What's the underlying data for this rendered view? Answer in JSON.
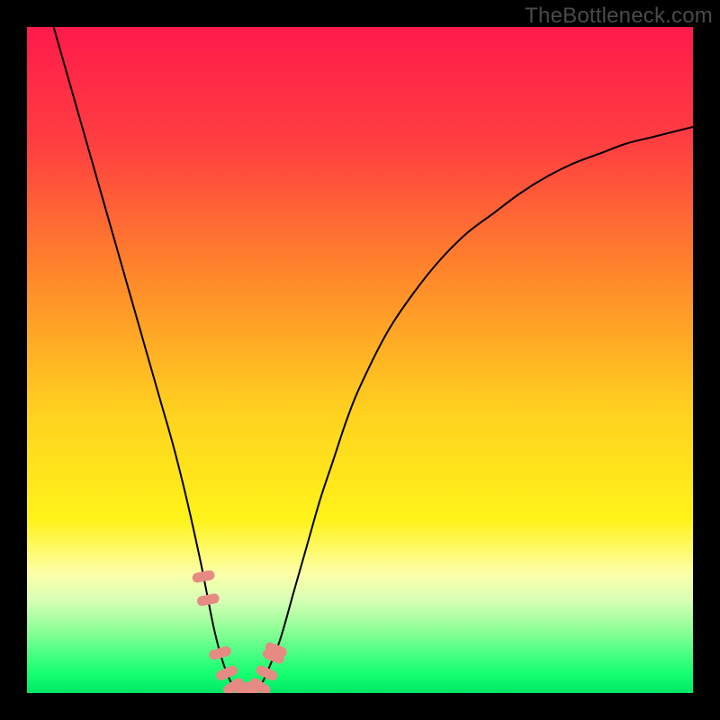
{
  "watermark": {
    "text": "TheBottleneck.com"
  },
  "chart_data": {
    "type": "line",
    "title": "",
    "xlabel": "",
    "ylabel": "",
    "xlim": [
      0,
      100
    ],
    "ylim": [
      0,
      100
    ],
    "series": [
      {
        "name": "bottleneck-curve",
        "x": [
          4,
          6,
          8,
          10,
          12,
          14,
          16,
          18,
          20,
          22,
          24,
          26,
          27,
          28,
          29,
          30,
          31,
          32,
          33,
          34,
          35,
          36,
          38,
          40,
          42,
          44,
          46,
          48,
          50,
          54,
          58,
          62,
          66,
          70,
          74,
          78,
          82,
          86,
          90,
          94,
          98,
          100
        ],
        "y": [
          100,
          93,
          86,
          79,
          72,
          65,
          58,
          51,
          44,
          37,
          29,
          20,
          15,
          10,
          6,
          3,
          1,
          0,
          0,
          0,
          1,
          3,
          8,
          15,
          22,
          29,
          35,
          41,
          46,
          54,
          60,
          65,
          69,
          72,
          75,
          77.5,
          79.5,
          81,
          82.5,
          83.5,
          84.5,
          85
        ]
      }
    ],
    "notch_markers": {
      "description": "salmon dashes along curve near minimum",
      "x": [
        26.5,
        27.2,
        29.0,
        30.0,
        31.0,
        32.0,
        33.0,
        34.0,
        35.0,
        36.0,
        37,
        37.4
      ]
    },
    "background_gradient": {
      "stops": [
        {
          "offset": 0.0,
          "color": "#ff1a4b"
        },
        {
          "offset": 0.18,
          "color": "#ff4040"
        },
        {
          "offset": 0.38,
          "color": "#ff8a2a"
        },
        {
          "offset": 0.58,
          "color": "#ffd21f"
        },
        {
          "offset": 0.74,
          "color": "#fff31a"
        },
        {
          "offset": 0.82,
          "color": "#fdffa8"
        },
        {
          "offset": 0.86,
          "color": "#d8ffb5"
        },
        {
          "offset": 0.9,
          "color": "#97ff9a"
        },
        {
          "offset": 0.94,
          "color": "#4cff83"
        },
        {
          "offset": 0.97,
          "color": "#17ff72"
        },
        {
          "offset": 1.0,
          "color": "#00e865"
        }
      ]
    }
  }
}
